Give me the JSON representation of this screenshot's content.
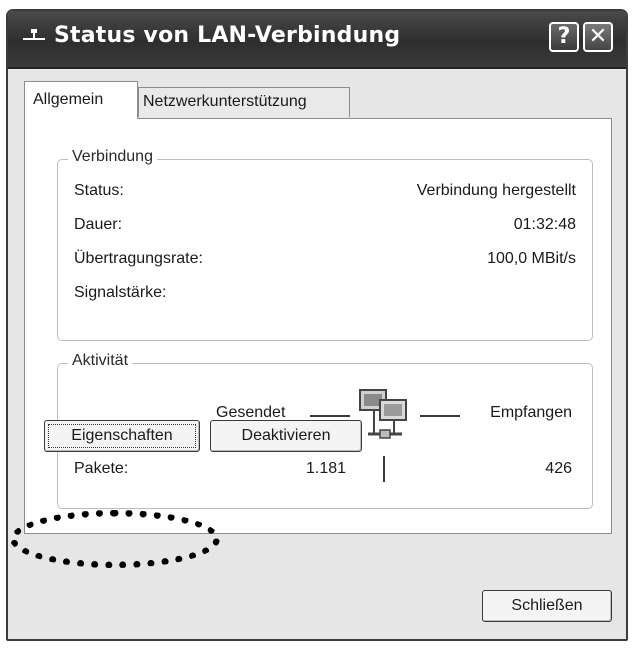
{
  "window": {
    "title": "Status von LAN-Verbindung",
    "help_label": "?",
    "close_label": "✕",
    "title_icon": "network-connection-icon"
  },
  "tabs": [
    {
      "label": "Allgemein",
      "active": true
    },
    {
      "label": "Netzwerkunterstützung",
      "active": false
    }
  ],
  "connection": {
    "legend": "Verbindung",
    "rows": [
      {
        "label": "Status:",
        "value": "Verbindung hergestellt"
      },
      {
        "label": "Dauer:",
        "value": "01:32:48"
      },
      {
        "label": "Übertragungsrate:",
        "value": "100,0 MBit/s"
      },
      {
        "label": "Signalstärke:",
        "value": ""
      }
    ]
  },
  "activity": {
    "legend": "Aktivität",
    "sent_label": "Gesendet",
    "received_label": "Empfangen",
    "packets_label": "Pakete:",
    "packets_sent": "1.181",
    "packets_received": "426",
    "icon": "network-activity-icon"
  },
  "buttons": {
    "properties": "Eigenschaften",
    "deactivate": "Deaktivieren",
    "close": "Schließen"
  },
  "colors": {
    "titlebar": "#2e2e2e",
    "window_bg": "#e6e6e6",
    "panel_bg": "#ffffff"
  }
}
